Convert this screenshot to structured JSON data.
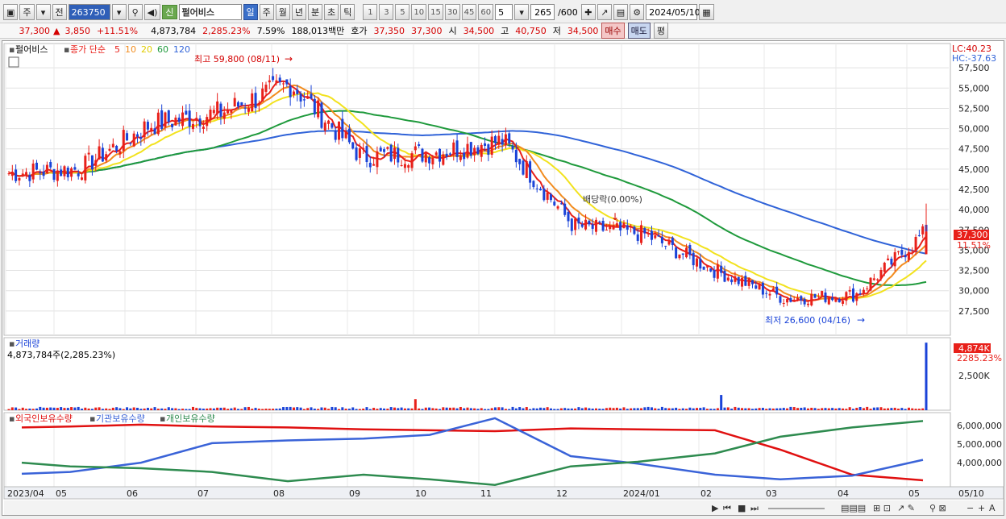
{
  "toolbar": {
    "market_button": "주",
    "prev_button": "전",
    "code": "263750",
    "credit_tag": "신",
    "stock_name": "펄어비스",
    "period_buttons": [
      "일",
      "주",
      "월",
      "년",
      "분",
      "초",
      "틱"
    ],
    "active_period": "일",
    "interval_buttons": [
      "1",
      "3",
      "5",
      "10",
      "15",
      "30",
      "45",
      "60"
    ],
    "interval_value": "5",
    "count": "265",
    "count_max": "/600",
    "date": "2024/05/10"
  },
  "quote": {
    "price": "37,300",
    "arrow": "▲",
    "change": "3,850",
    "change_rate": "+11.51%",
    "volume": "4,873,784",
    "volume_rate": "2,285.23%",
    "turnover_rate": "7.59%",
    "amount": "188,013백만",
    "hoga_label": "호가",
    "ask": "37,350",
    "bid": "37,300",
    "open_label": "시",
    "open": "34,500",
    "high_label": "고",
    "high": "40,750",
    "low_label": "저",
    "low": "34,500",
    "buy_button": "매수",
    "sell_button": "매도",
    "eval_button": "평"
  },
  "colors": {
    "up": "#e8201a",
    "down": "#1a43d8",
    "ma5": "#e8201a",
    "ma10": "#f28c1e",
    "ma20": "#f2e21e",
    "ma60": "#1f9a3c",
    "ma120": "#3063d8",
    "foreign": "#e01010",
    "institution": "#3a63d8",
    "individual": "#2e8b4f"
  },
  "chart_data": [
    {
      "type": "candlestick",
      "title": "펄어비스",
      "legend": {
        "label": "종가 단순",
        "periods": [
          "5",
          "10",
          "20",
          "60",
          "120"
        ]
      },
      "y_ticks": [
        "57,500",
        "55,000",
        "52,500",
        "50,000",
        "47,500",
        "45,000",
        "42,500",
        "40,000",
        "37,500",
        "35,000",
        "32,500",
        "30,000",
        "27,500"
      ],
      "y_values": [
        57500,
        55000,
        52500,
        50000,
        47500,
        45000,
        42500,
        40000,
        37500,
        35000,
        32500,
        30000,
        27500
      ],
      "ylim": [
        24500,
        60500
      ],
      "x_ticks": [
        "2023/04",
        "05",
        "06",
        "07",
        "08",
        "09",
        "10",
        "11",
        "12",
        "2024/01",
        "02",
        "03",
        "04",
        "05",
        "05/10"
      ],
      "lc_label": "LC:40.23",
      "hc_label": "HC:-37.63",
      "last_price_label": "37,300",
      "last_change_label": "11.51%",
      "max_annotation": "최고 59,800 (08/11)",
      "min_annotation": "최저 26,600 (04/16)",
      "dividend_annotation": "배당락(0.00%)",
      "price_series": {
        "months": [
          "2023/04",
          "05",
          "06",
          "07",
          "08",
          "09",
          "10",
          "11",
          "12",
          "2024/01",
          "02",
          "03",
          "04",
          "05"
        ],
        "close_monthly": [
          44500,
          45000,
          50500,
          52000,
          55500,
          46500,
          47000,
          48500,
          38000,
          37000,
          32500,
          29000,
          29500,
          37300
        ]
      }
    },
    {
      "type": "bar",
      "title": "거래량",
      "value_label": "4,873,784주(2,285.23%)",
      "last_label": "4,874K",
      "last_rate_label": "2285.23%",
      "y_ticks": [
        "2,500K"
      ],
      "y_values": [
        2500000
      ],
      "ylim": [
        0,
        5000000
      ]
    },
    {
      "type": "line",
      "series": [
        {
          "name": "외국인보유수량",
          "color": "#e01010",
          "values": [
            5900000,
            5950000,
            6050000,
            5950000,
            5900000,
            5800000,
            5750000,
            5700000,
            5850000,
            5800000,
            5750000,
            4700000,
            3350000,
            3050000
          ]
        },
        {
          "name": "기관보유수량",
          "color": "#3a63d8",
          "values": [
            3400000,
            3500000,
            4000000,
            5050000,
            5200000,
            5300000,
            5500000,
            6400000,
            4350000,
            3950000,
            3350000,
            3100000,
            3300000,
            4150000
          ]
        },
        {
          "name": "개인보유수량",
          "color": "#2e8b4f",
          "values": [
            4000000,
            3800000,
            3700000,
            3500000,
            3000000,
            3350000,
            3100000,
            2800000,
            3800000,
            4050000,
            4500000,
            5400000,
            5900000,
            6250000
          ]
        }
      ],
      "y_ticks": [
        "6,000,000",
        "5,000,000",
        "4,000,000"
      ],
      "y_values": [
        6000000,
        5000000,
        4000000
      ],
      "ylim": [
        2700000,
        6700000
      ]
    }
  ]
}
